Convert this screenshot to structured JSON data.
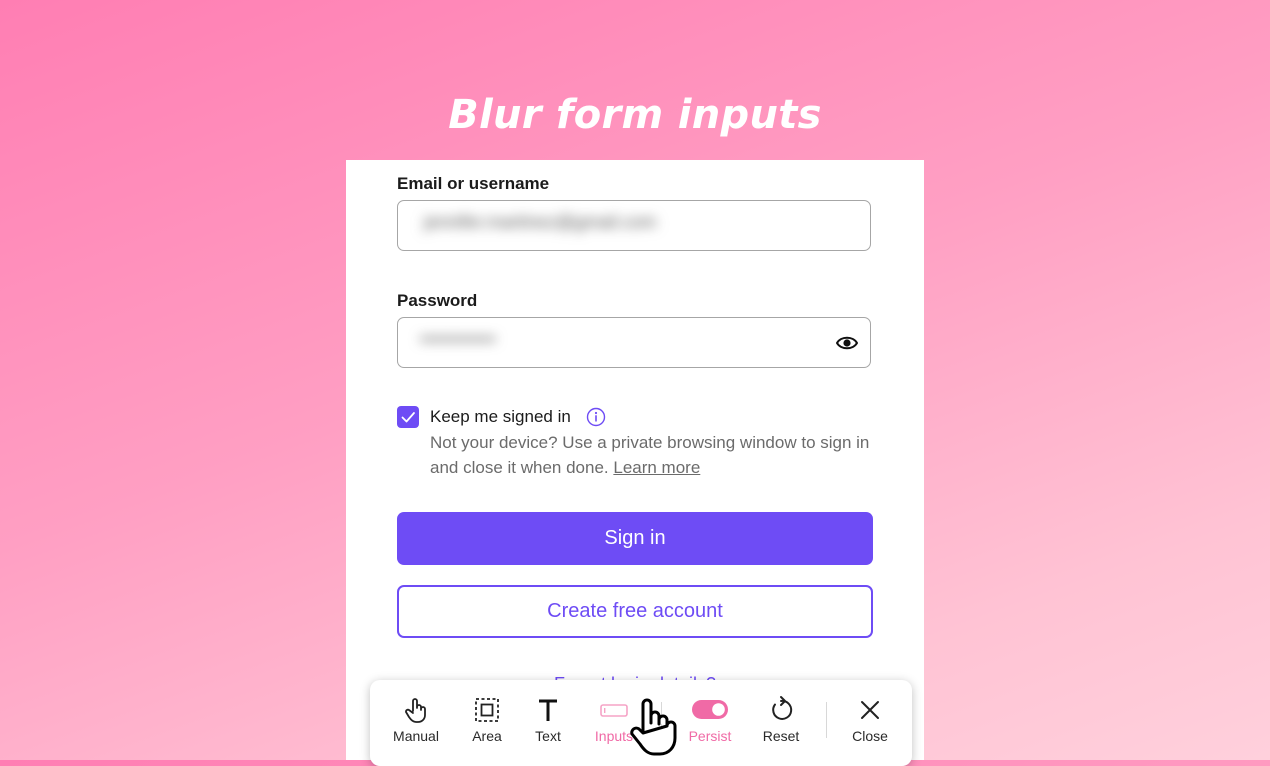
{
  "headline": "Blur form inputs",
  "form": {
    "email_label": "Email or username",
    "email_value": "jennifer.martinez@gmail.com",
    "password_label": "Password",
    "password_value": "••••••••••••",
    "keep_signed_in_label": "Keep me signed in",
    "keep_signed_in_checked": true,
    "hint_text": "Not your device? Use a private browsing window to sign in and close it when done.",
    "learn_more": "Learn more",
    "sign_in_label": "Sign in",
    "create_account_label": "Create free account",
    "forgot_label": "Forgot login details?"
  },
  "toolbar": {
    "manual": "Manual",
    "area": "Area",
    "text": "Text",
    "inputs": "Inputs",
    "persist": "Persist",
    "reset": "Reset",
    "close": "Close"
  },
  "colors": {
    "accent": "#6e4cf5",
    "toolbar_active": "#f06aa6",
    "background_start": "#ff7eb3",
    "background_end": "#ffd0dc"
  }
}
